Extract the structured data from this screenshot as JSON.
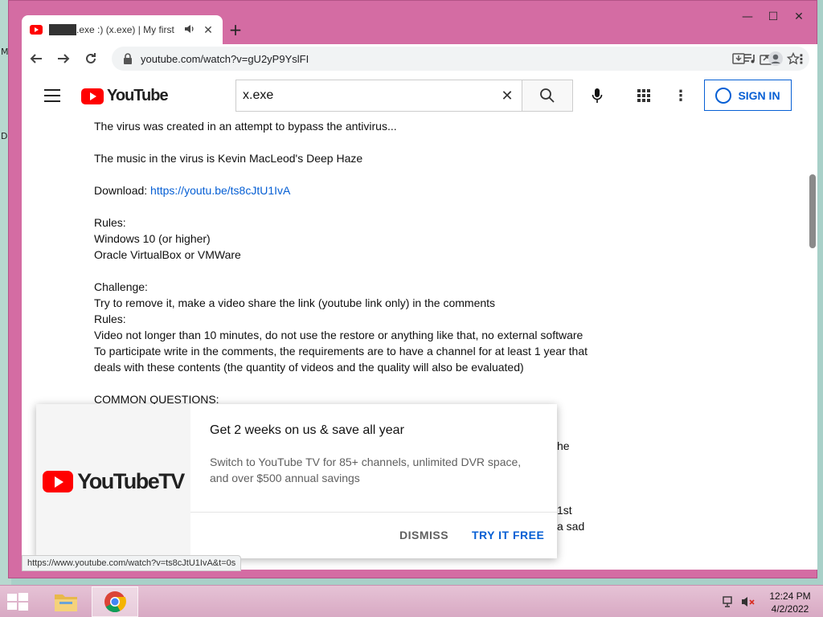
{
  "desktop": {
    "glyph_top": "M",
    "glyph_mid": "D"
  },
  "tab": {
    "title": "████.exe :) (x.exe) | My first",
    "audio_icon": "speaker-icon",
    "close_symbol": "✕"
  },
  "new_tab_symbol": "+",
  "window_controls": {
    "minimize": "—",
    "maximize": "☐",
    "close": "✕"
  },
  "address_bar": {
    "url": "youtube.com/watch?v=gU2yP9YslFI"
  },
  "youtube": {
    "logo_text": "YouTube",
    "search_value": "x.exe",
    "search_clear": "✕",
    "more_symbol": "⋮",
    "signin_label": "SIGN IN"
  },
  "description": {
    "lines": [
      "The virus was created in an attempt to bypass the antivirus...",
      "",
      "The music in the virus is Kevin MacLeod's Deep Haze",
      "",
      "Download: ",
      "",
      "Rules:",
      "Windows 10 (or higher)",
      "Oracle VirtualBox or VMWare",
      "",
      "Challenge:",
      "Try to remove it, make a video share the link (youtube link only) in the comments",
      "Rules:",
      "Video not longer than 10 minutes, do not use the restore or anything like that, no external software",
      "To participate write in the comments, the requirements are to have a channel for at least 1 year that",
      "deals with these contents (the quantity of videos and the quality will also be evaluated)",
      "",
      "COMMON QUESTIONS:"
    ],
    "download_link": "https://youtu.be/ts8cJtU1IvA",
    "frag_he": "he",
    "frag_1st": "1st",
    "frag_sad": "a sad"
  },
  "promo": {
    "logo_text": "YouTubeTV",
    "title": "Get 2 weeks on us & save all year",
    "body": "Switch to YouTube TV for 85+ channels, unlimited DVR space, and over $500 annual savings",
    "dismiss_label": "DISMISS",
    "try_label": "TRY IT FREE"
  },
  "status_url": "https://www.youtube.com/watch?v=ts8cJtU1IvA&t=0s",
  "taskbar": {
    "time": "12:24 PM",
    "date": "4/2/2022"
  },
  "colors": {
    "frame": "#d46ca3",
    "youtube_red": "#ff0000",
    "link_blue": "#065fd4"
  }
}
